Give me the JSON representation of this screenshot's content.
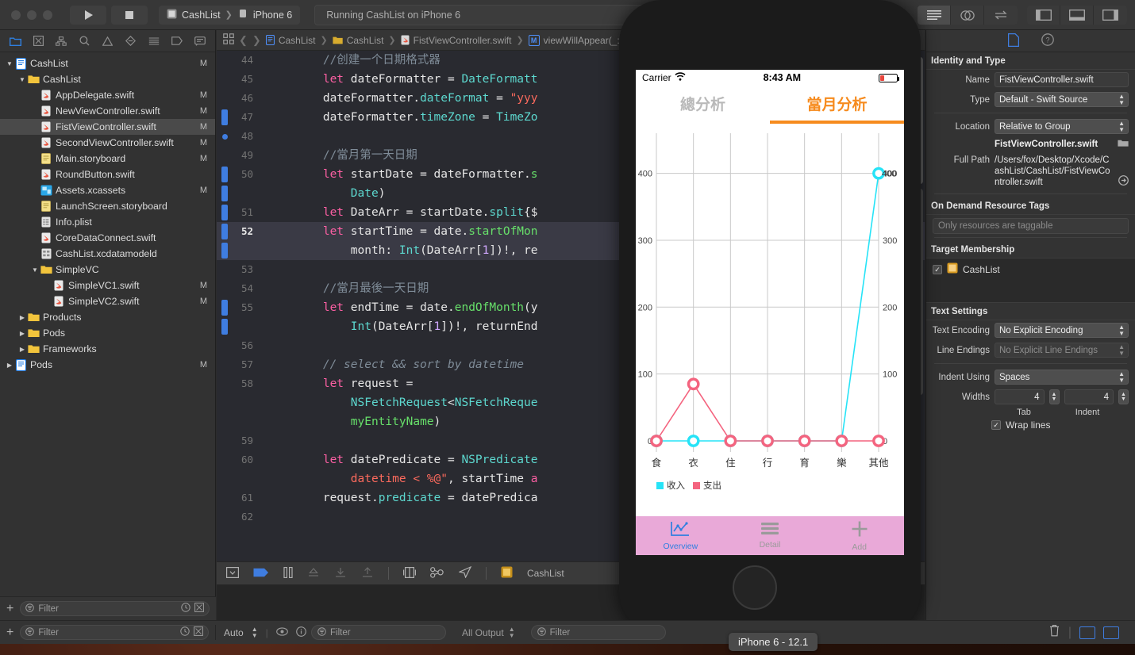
{
  "toolbar": {
    "scheme_project": "CashList",
    "scheme_device": "iPhone 6",
    "status_text": "Running CashList on iPhone 6",
    "play_icon": "play-icon",
    "stop_icon": "stop-icon"
  },
  "navigator": {
    "tabs": [
      "folder-icon",
      "issue-icon",
      "hierarchy-icon",
      "search-icon",
      "warning-icon",
      "breakpoint-icon",
      "report-icon",
      "tag-icon",
      "comment-icon"
    ],
    "filter_placeholder": "Filter",
    "items": [
      {
        "label": "CashList",
        "mark": "M",
        "indent": 0,
        "disc": "down",
        "icon": "project-icon"
      },
      {
        "label": "CashList",
        "mark": "",
        "indent": 1,
        "disc": "down",
        "icon": "folder-icon"
      },
      {
        "label": "AppDelegate.swift",
        "mark": "M",
        "indent": 2,
        "disc": "",
        "icon": "swift-icon"
      },
      {
        "label": "NewViewController.swift",
        "mark": "M",
        "indent": 2,
        "disc": "",
        "icon": "swift-icon"
      },
      {
        "label": "FistViewController.swift",
        "mark": "M",
        "indent": 2,
        "disc": "",
        "icon": "swift-icon",
        "selected": true
      },
      {
        "label": "SecondViewController.swift",
        "mark": "M",
        "indent": 2,
        "disc": "",
        "icon": "swift-icon"
      },
      {
        "label": "Main.storyboard",
        "mark": "M",
        "indent": 2,
        "disc": "",
        "icon": "storyboard-icon"
      },
      {
        "label": "RoundButton.swift",
        "mark": "",
        "indent": 2,
        "disc": "",
        "icon": "swift-icon"
      },
      {
        "label": "Assets.xcassets",
        "mark": "M",
        "indent": 2,
        "disc": "",
        "icon": "assets-icon"
      },
      {
        "label": "LaunchScreen.storyboard",
        "mark": "",
        "indent": 2,
        "disc": "",
        "icon": "storyboard-icon"
      },
      {
        "label": "Info.plist",
        "mark": "",
        "indent": 2,
        "disc": "",
        "icon": "plist-icon"
      },
      {
        "label": "CoreDataConnect.swift",
        "mark": "",
        "indent": 2,
        "disc": "",
        "icon": "swift-icon"
      },
      {
        "label": "CashList.xcdatamodeld",
        "mark": "",
        "indent": 2,
        "disc": "",
        "icon": "datamodel-icon"
      },
      {
        "label": "SimpleVC",
        "mark": "",
        "indent": 2,
        "disc": "down",
        "icon": "folder-icon"
      },
      {
        "label": "SimpleVC1.swift",
        "mark": "M",
        "indent": 3,
        "disc": "",
        "icon": "swift-icon"
      },
      {
        "label": "SimpleVC2.swift",
        "mark": "M",
        "indent": 3,
        "disc": "",
        "icon": "swift-icon"
      },
      {
        "label": "Products",
        "mark": "",
        "indent": 1,
        "disc": "right",
        "icon": "folder-icon"
      },
      {
        "label": "Pods",
        "mark": "",
        "indent": 1,
        "disc": "right",
        "icon": "folder-icon"
      },
      {
        "label": "Frameworks",
        "mark": "",
        "indent": 1,
        "disc": "right",
        "icon": "folder-icon"
      },
      {
        "label": "Pods",
        "mark": "M",
        "indent": 0,
        "disc": "right",
        "icon": "project-icon"
      }
    ]
  },
  "editor": {
    "breadcrumb": [
      "CashList",
      "CashList",
      "FistViewController.swift",
      "viewWillAppear(_:)"
    ],
    "breadcrumb_badge": "M",
    "lines": [
      {
        "num": "44",
        "marker": "",
        "html": "        <span class=\"cm\">//创建一个日期格式器</span>"
      },
      {
        "num": "45",
        "marker": "",
        "html": "        <span class=\"k\">let</span> dateFormatter = <span class=\"ty\">DateFormatt</span>"
      },
      {
        "num": "46",
        "marker": "",
        "html": "        dateFormatter.<span class=\"ty\">dateFormat</span> = <span class=\"st\">\"yyy</span>"
      },
      {
        "num": "47",
        "marker": "bar",
        "html": "        dateFormatter.<span class=\"ty\">timeZone</span> = <span class=\"ty\">TimeZo</span>"
      },
      {
        "num": "48",
        "marker": "dot",
        "html": ""
      },
      {
        "num": "49",
        "marker": "",
        "html": "        <span class=\"cm\">//當月第一天日期</span>"
      },
      {
        "num": "50",
        "marker": "bar",
        "html": "        <span class=\"k\">let</span> startDate = dateFormatter.<span class=\"fn\">s</span>"
      },
      {
        "num": "",
        "marker": "bar",
        "html": "            <span class=\"ty\">Date</span>)"
      },
      {
        "num": "51",
        "marker": "bar",
        "html": "        <span class=\"k\">let</span> DateArr = startDate.<span class=\"ty\">split</span>{$"
      },
      {
        "num": "52",
        "marker": "bar",
        "hl": true,
        "html": "        <span class=\"k\">let</span> startTime = date.<span class=\"fn\">startOfMon</span>"
      },
      {
        "num": "",
        "marker": "bar",
        "hl": true,
        "html": "            month: <span class=\"ty\">Int</span>(DateArr[<span class=\"nu\">1</span>])!, re"
      },
      {
        "num": "53",
        "marker": "",
        "html": ""
      },
      {
        "num": "54",
        "marker": "",
        "html": "        <span class=\"cm\">//當月最後一天日期</span>"
      },
      {
        "num": "55",
        "marker": "bar",
        "html": "        <span class=\"k\">let</span> endTime = date.<span class=\"fn\">endOfMonth</span>(y"
      },
      {
        "num": "",
        "marker": "bar",
        "html": "            <span class=\"ty\">Int</span>(DateArr[<span class=\"nu\">1</span>])!, returnEnd"
      },
      {
        "num": "56",
        "marker": "",
        "html": ""
      },
      {
        "num": "57",
        "marker": "",
        "html": "        <span class=\"cm\"><i>// select &amp;&amp; sort by datetime</i></span>"
      },
      {
        "num": "58",
        "marker": "",
        "html": "        <span class=\"k\">let</span> request ="
      },
      {
        "num": "",
        "marker": "",
        "html": "            <span class=\"ty\">NSFetchRequest</span>&lt;<span class=\"ty\">NSFetchReque</span>"
      },
      {
        "num": "",
        "marker": "",
        "html": "            <span class=\"fn\">myEntityName</span>)"
      },
      {
        "num": "59",
        "marker": "",
        "html": ""
      },
      {
        "num": "60",
        "marker": "",
        "html": "        <span class=\"k\">let</span> datePredicate = <span class=\"ty\">NSPredicate</span>"
      },
      {
        "num": "",
        "marker": "",
        "html": "            <span class=\"st\">datetime &lt; %@\"</span>, startTime <span class=\"k\">a</span>"
      },
      {
        "num": "61",
        "marker": "",
        "html": "        request.<span class=\"ty\">predicate</span> = datePredica"
      },
      {
        "num": "62",
        "marker": "",
        "html": ""
      }
    ],
    "debug_bar_target": "CashList"
  },
  "inspector": {
    "tabs": [
      "file-inspector-icon",
      "help-inspector-icon"
    ],
    "identity_header": "Identity and Type",
    "name_label": "Name",
    "name_value": "FistViewController.swift",
    "type_label": "Type",
    "type_value": "Default - Swift Source",
    "location_label": "Location",
    "location_value": "Relative to Group",
    "location_file": "FistViewController.swift",
    "fullpath_label": "Full Path",
    "fullpath_value": "/Users/fox/Desktop/Xcode/CashList/CashList/FistViewController.swift",
    "odr_header": "On Demand Resource Tags",
    "odr_placeholder": "Only resources are taggable",
    "target_header": "Target Membership",
    "target_item": "CashList",
    "target_checked": "✓",
    "text_header": "Text Settings",
    "encoding_label": "Text Encoding",
    "encoding_value": "No Explicit Encoding",
    "lineendings_label": "Line Endings",
    "lineendings_value": "No Explicit Line Endings",
    "indent_label": "Indent Using",
    "indent_value": "Spaces",
    "widths_label": "Widths",
    "tab_width": "4",
    "indent_width": "4",
    "tab_caption": "Tab",
    "indent_caption": "Indent",
    "wrap_label": "Wrap lines",
    "wrap_checked": "✓"
  },
  "simulator": {
    "carrier": "Carrier",
    "time": "8:43 AM",
    "tabs": [
      {
        "label": "總分析",
        "active": false
      },
      {
        "label": "當月分析",
        "active": true
      }
    ],
    "tabbar": [
      {
        "label": "Overview",
        "icon": "chart-icon",
        "active": true
      },
      {
        "label": "Detail",
        "icon": "list-icon",
        "active": false
      },
      {
        "label": "Add",
        "icon": "plus-icon",
        "active": false
      }
    ],
    "tooltip": "iPhone 6 - 12.1"
  },
  "chart_data": {
    "type": "line",
    "title": "",
    "categories": [
      "食",
      "衣",
      "住",
      "行",
      "育",
      "樂",
      "其他"
    ],
    "series": [
      {
        "name": "收入",
        "color": "#26e3f7",
        "values": [
          0,
          0,
          0,
          0,
          0,
          0,
          400
        ]
      },
      {
        "name": "支出",
        "color": "#f4647f",
        "values": [
          0,
          85,
          0,
          0,
          0,
          0,
          0
        ]
      }
    ],
    "ylim": [
      0,
      460
    ],
    "yticks": [
      100,
      200,
      300,
      400
    ],
    "ytick_labels_left": [
      "100",
      "200",
      "300",
      "400"
    ],
    "ytick_labels_right": [
      "100",
      "200",
      "300",
      "400"
    ],
    "zero_label_left": "0",
    "zero_label_right": "0",
    "point_labels": {
      "income_last_left": "400",
      "income_last_right": "400"
    },
    "grid": true,
    "legend_position": "bottom-left",
    "xlabel": "",
    "ylabel": ""
  },
  "bottom": {
    "auto_label": "Auto",
    "dbg_filter_placeholder": "Filter",
    "all_output": "All Output",
    "console_filter_placeholder": "Filter",
    "trash_icon": "trash-icon"
  }
}
